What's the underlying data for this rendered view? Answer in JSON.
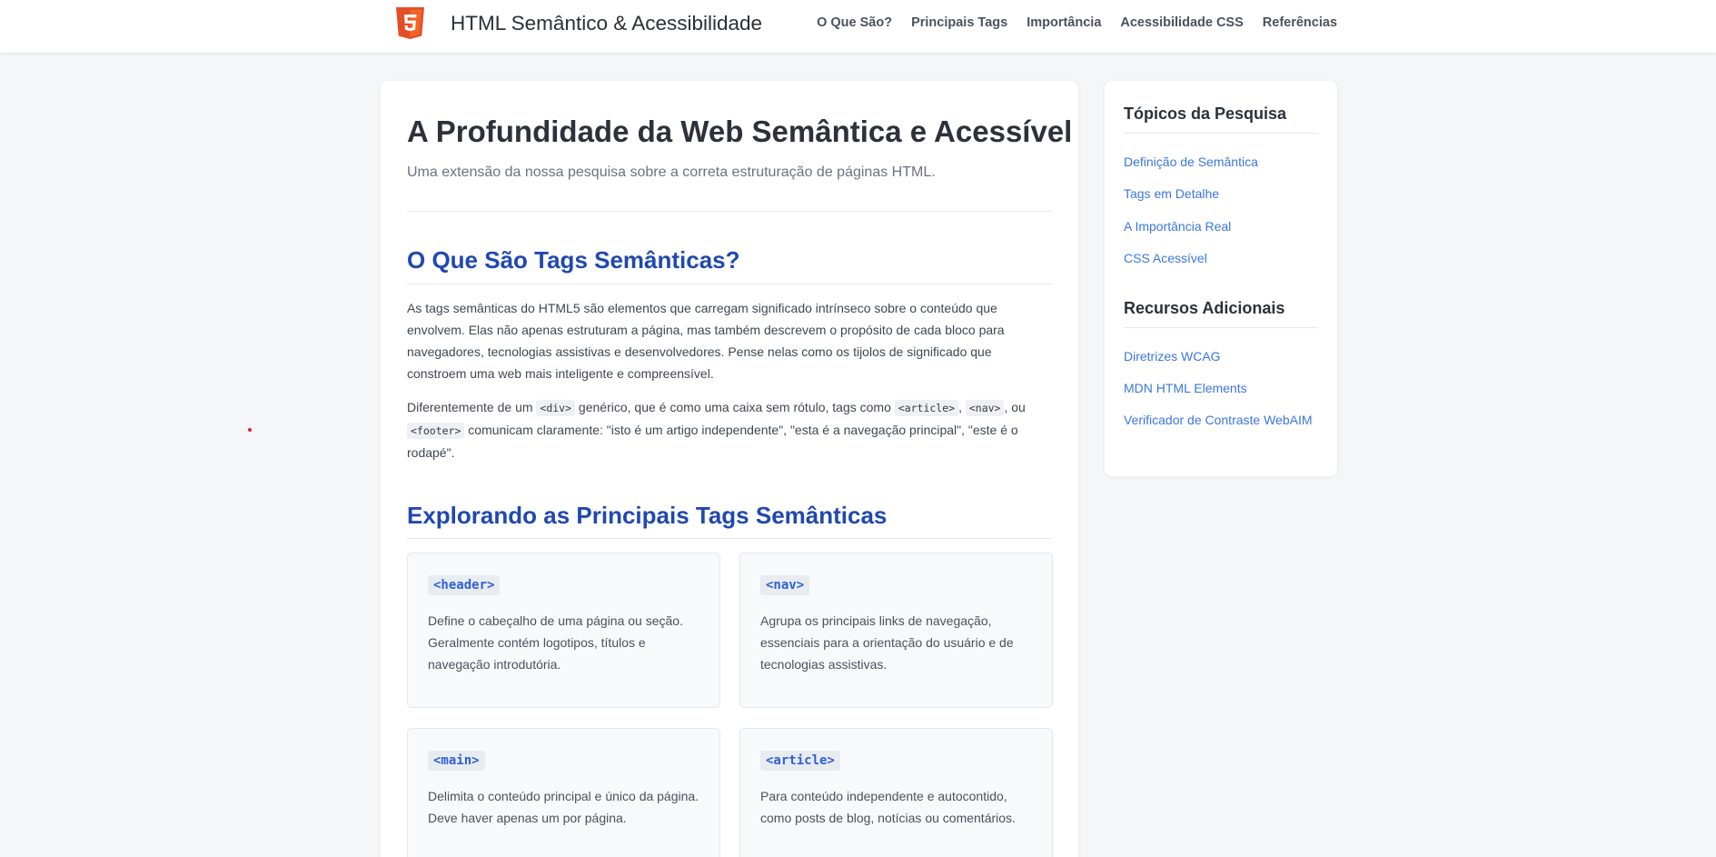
{
  "header": {
    "logo_icon": "html5-icon",
    "title": "HTML Semântico & Acessibilidade",
    "nav": [
      "O Que São?",
      "Principais Tags",
      "Importância",
      "Acessibilidade CSS",
      "Referências"
    ]
  },
  "main": {
    "title": "A Profundidade da Web Semântica e Acessível",
    "subtitle": "Uma extensão da nossa pesquisa sobre a correta estruturação de páginas HTML.",
    "section1": {
      "title": "O Que São Tags Semânticas?",
      "p1": "As tags semânticas do HTML5 são elementos que carregam significado intrínseco sobre o conteúdo que envolvem. Elas não apenas estruturam a página, mas também descrevem o propósito de cada bloco para navegadores, tecnologias assistivas e desenvolvedores. Pense nelas como os tijolos de significado que constroem uma web mais inteligente e compreensível.",
      "p2": {
        "t1": "Diferentemente de um ",
        "c1": "<div>",
        "t2": " genérico, que é como uma caixa sem rótulo, tags como ",
        "c2": "<article>",
        "t3": ", ",
        "c3": "<nav>",
        "t4": ", ou ",
        "c4": "<footer>",
        "t5": " comunicam claramente: \"isto é um artigo independente\", \"esta é a navegação principal\", \"este é o rodapé\"."
      }
    },
    "section2": {
      "title": "Explorando as Principais Tags Semânticas",
      "cards": [
        {
          "tag": "<header>",
          "desc": "Define o cabeçalho de uma página ou seção. Geralmente contém logotipos, títulos e navegação introdutória."
        },
        {
          "tag": "<nav>",
          "desc": "Agrupa os principais links de navegação, essenciais para a orientação do usuário e de tecnologias assistivas."
        },
        {
          "tag": "<main>",
          "desc": "Delimita o conteúdo principal e único da página. Deve haver apenas um por página."
        },
        {
          "tag": "<article>",
          "desc": "Para conteúdo independente e autocontido, como posts de blog, notícias ou comentários."
        }
      ]
    }
  },
  "sidebar": {
    "topics_heading": "Tópicos da Pesquisa",
    "topics": [
      "Definição de Semântica",
      "Tags em Detalhe",
      "A Importância Real",
      "CSS Acessível"
    ],
    "resources_heading": "Recursos Adicionais",
    "resources": [
      "Diretrizes WCAG",
      "MDN HTML Elements",
      "Verificador de Contraste WebAIM"
    ]
  },
  "colors": {
    "accent": "#2148b0",
    "link": "#3b76e0",
    "html5_orange": "#e44d26"
  }
}
